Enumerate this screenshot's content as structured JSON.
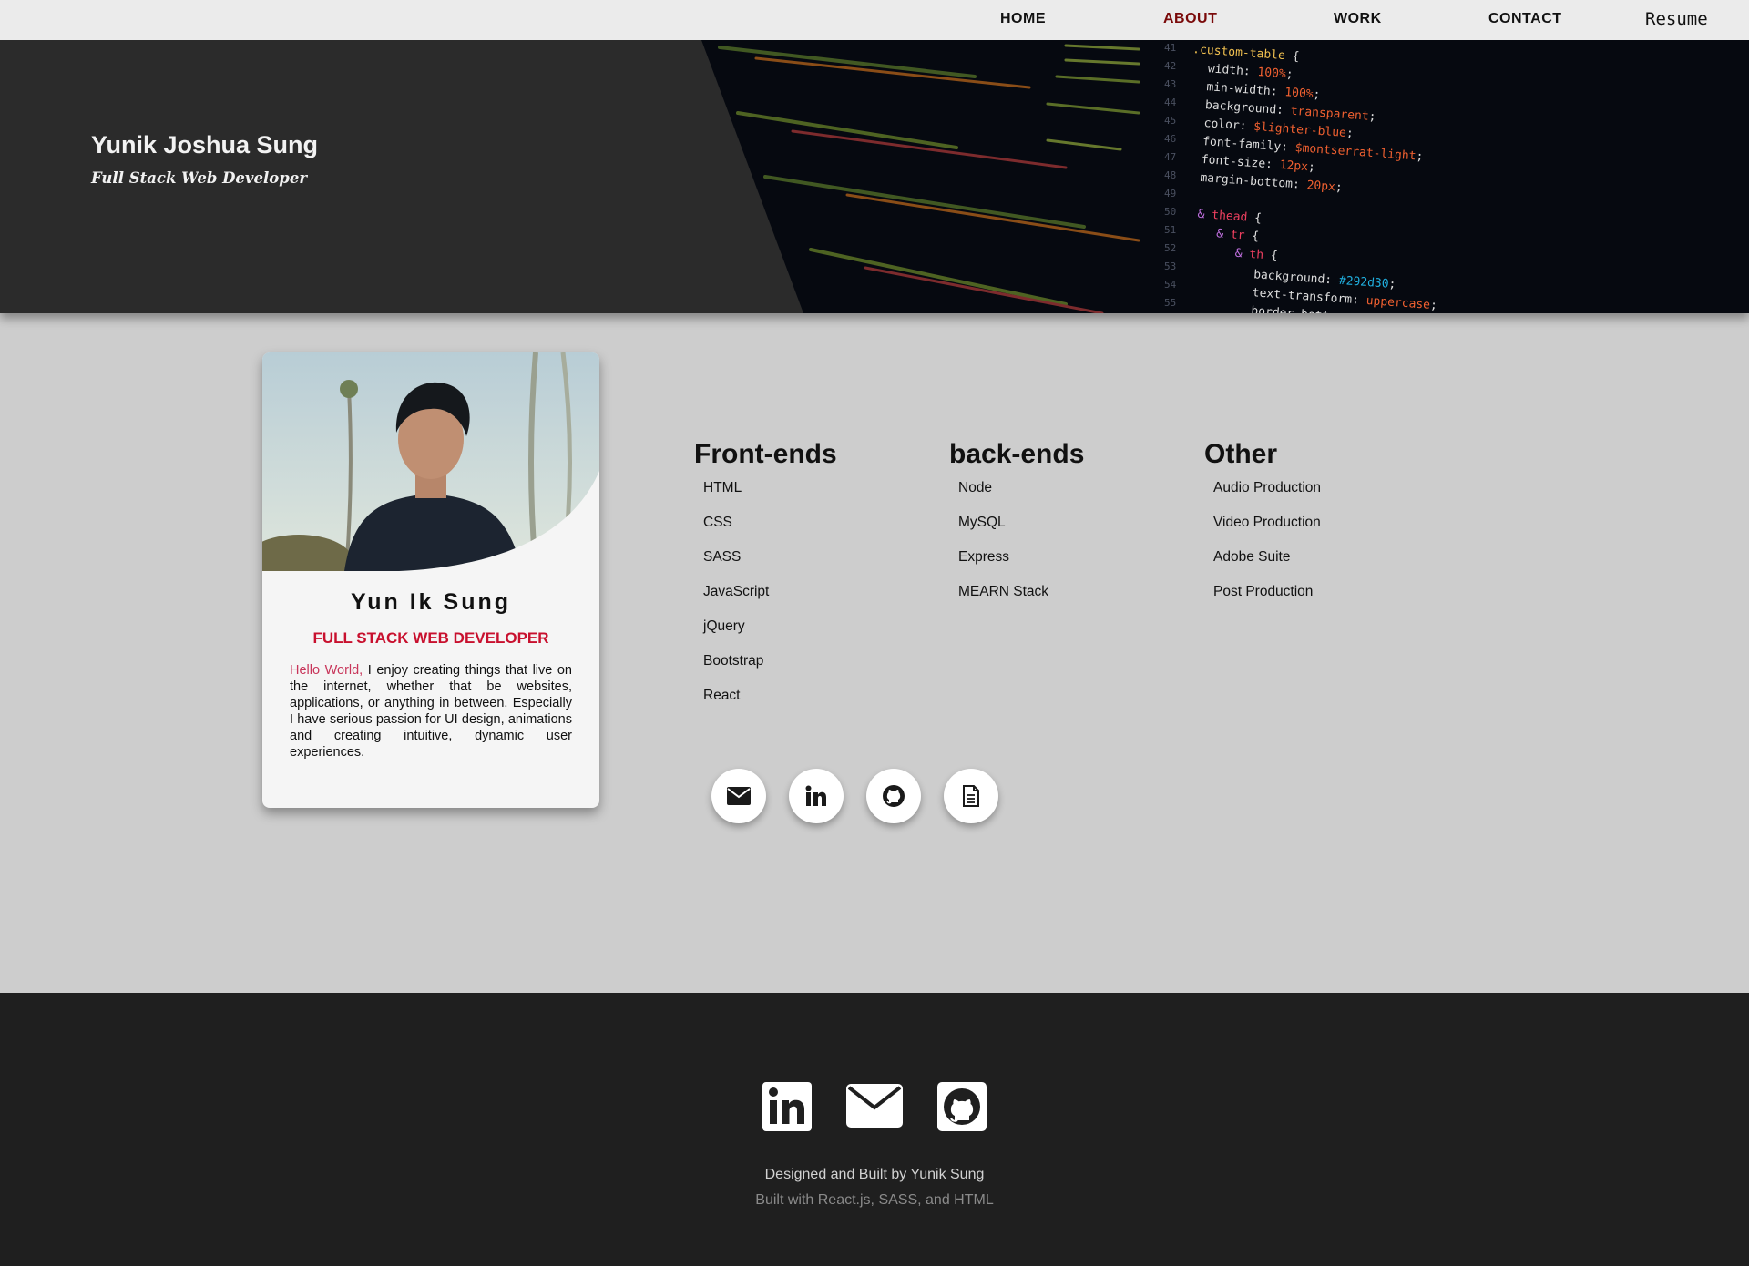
{
  "nav": {
    "items": [
      {
        "label": "HOME"
      },
      {
        "label": "ABOUT"
      },
      {
        "label": "WORK"
      },
      {
        "label": "CONTACT"
      }
    ],
    "resume_label": "Resume",
    "active_color": "#7a0a0a"
  },
  "hero": {
    "name": "Yunik Joshua Sung",
    "subtitle": "Full Stack Web Developer"
  },
  "profile": {
    "name": "Yun Ik Sung",
    "role": "FULL STACK WEB DEVELOPER",
    "bio_greeting": "Hello World,",
    "bio_text": " I enjoy creating things that live on the internet, whether that be websites, applications, or anything in between. Especially I have serious passion for UI design, animations and creating intuitive, dynamic user experiences.",
    "accent_color": "#c8102e"
  },
  "skills": [
    {
      "title": "Front-ends",
      "items": [
        "HTML",
        "CSS",
        "SASS",
        "JavaScript",
        "jQuery",
        "Bootstrap",
        "React"
      ]
    },
    {
      "title": "back-ends",
      "items": [
        "Node",
        "MySQL",
        "Express",
        "MEARN Stack"
      ]
    },
    {
      "title": "Other",
      "items": [
        "Audio Production",
        "Video Production",
        "Adobe Suite",
        "Post Production"
      ]
    }
  ],
  "social_buttons": [
    "envelope-icon",
    "linkedin-icon",
    "github-icon",
    "document-icon"
  ],
  "footer": {
    "icons": [
      "linkedin-icon",
      "envelope-icon",
      "github-icon"
    ],
    "credit": "Designed and Built by Yunik Sung",
    "built_with": "Built with React.js, SASS, and HTML"
  }
}
